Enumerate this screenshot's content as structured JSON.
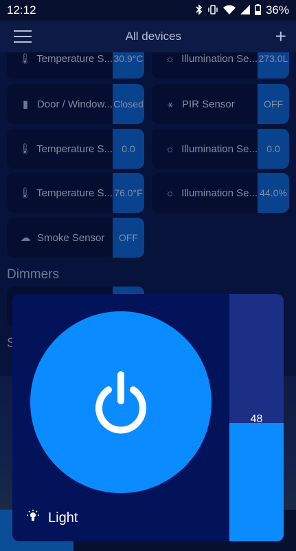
{
  "status_bar": {
    "time": "12:12",
    "battery": "36%",
    "icons": [
      "bluetooth-icon",
      "vibrate-icon",
      "wifi-icon",
      "signal-icon",
      "battery-icon"
    ]
  },
  "app_bar": {
    "title": "All devices",
    "menu_icon": "hamburger-icon",
    "add_icon": "plus-icon"
  },
  "sensors": [
    {
      "label": "Temperature S...",
      "value": "30.9°C",
      "icon": "thermometer-icon"
    },
    {
      "label": "Illumination Se...",
      "value": "273.0L",
      "icon": "sun-icon"
    },
    {
      "label": "Door / Window...",
      "value": "Closed",
      "icon": "door-icon"
    },
    {
      "label": "PIR Sensor",
      "value": "OFF",
      "icon": "motion-icon"
    },
    {
      "label": "Temperature S...",
      "value": "0.0",
      "icon": "thermometer-icon"
    },
    {
      "label": "Illumination Se...",
      "value": "0.0",
      "icon": "sun-icon"
    },
    {
      "label": "Temperature S...",
      "value": "76.0°F",
      "icon": "thermometer-icon"
    },
    {
      "label": "Illumination Se...",
      "value": "44.0%",
      "icon": "sun-icon"
    },
    {
      "label": "Smoke Sensor",
      "value": "OFF",
      "icon": "smoke-icon"
    }
  ],
  "sections": {
    "dimmers": "Dimmers",
    "partial": "S"
  },
  "dialog": {
    "device_name": "Light",
    "device_icon": "lightbulb-icon",
    "power_icon": "power-icon",
    "level": 48,
    "level_fraction": 0.48,
    "colors": {
      "dialog_bg": "#02135a",
      "accent": "#0a8bff",
      "slider_track": "#1a2f85"
    }
  }
}
